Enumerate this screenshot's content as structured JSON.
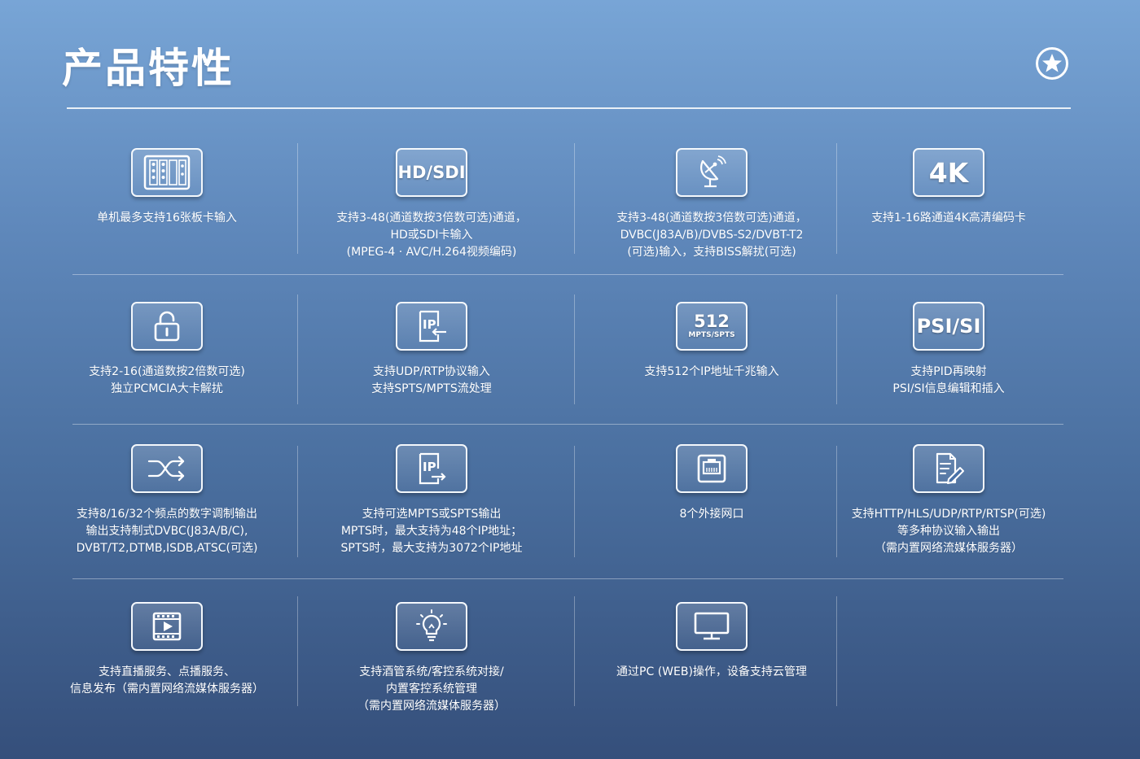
{
  "page": {
    "title": "产品特性"
  },
  "icons": {
    "star": "star-badge-icon"
  },
  "features": [
    {
      "icon": "board-card-icon",
      "text": "单机最多支持16张板卡输入"
    },
    {
      "icon": "hd-sdi-icon",
      "icon_label": "HD/SDI",
      "text": "支持3-48(通道数按3倍数可选)通道，\nHD或SDI卡输入\n(MPEG-4 · AVC/H.264视频编码)"
    },
    {
      "icon": "satellite-dish-icon",
      "text": "支持3-48(通道数按3倍数可选)通道，\nDVBC(J83A/B)/DVBS-S2/DVBT-T2\n(可选)输入，支持BISS解扰(可选)"
    },
    {
      "icon": "4k-icon",
      "icon_label": "4K",
      "text": "支持1-16路通道4K高清编码卡"
    },
    {
      "icon": "unlock-icon",
      "text": "支持2-16(通道数按2倍数可选)\n独立PCMCIA大卡解扰"
    },
    {
      "icon": "ip-input-icon",
      "icon_label": "IP",
      "text": "支持UDP/RTP协议输入\n支持SPTS/MPTS流处理"
    },
    {
      "icon": "512-mpts-icon",
      "icon_label": "512",
      "icon_sublabel": "MPTS/SPTS",
      "text": "支持512个IP地址千兆输入"
    },
    {
      "icon": "psi-si-icon",
      "icon_label": "PSI/SI",
      "text": "支持PID再映射\nPSI/SI信息编辑和插入"
    },
    {
      "icon": "shuffle-icon",
      "text": "支持8/16/32个频点的数字调制输出\n输出支持制式DVBC(J83A/B/C),\nDVBT/T2,DTMB,ISDB,ATSC(可选)"
    },
    {
      "icon": "ip-output-icon",
      "icon_label": "IP",
      "text": "支持可选MPTS或SPTS输出\nMPTS时，最大支持为48个IP地址；\nSPTS时，最大支持为3072个IP地址"
    },
    {
      "icon": "ethernet-port-icon",
      "text": "8个外接网口"
    },
    {
      "icon": "document-edit-icon",
      "text": "支持HTTP/HLS/UDP/RTP/RTSP(可选)\n等多种协议输入输出\n（需内置网络流媒体服务器）"
    },
    {
      "icon": "video-play-icon",
      "text": "支持直播服务、点播服务、\n信息发布（需内置网络流媒体服务器）"
    },
    {
      "icon": "lightbulb-icon",
      "text": "支持酒管系统/客控系统对接/\n内置客控系统管理\n（需内置网络流媒体服务器）"
    },
    {
      "icon": "monitor-icon",
      "text": "通过PC (WEB)操作，设备支持云管理"
    }
  ]
}
